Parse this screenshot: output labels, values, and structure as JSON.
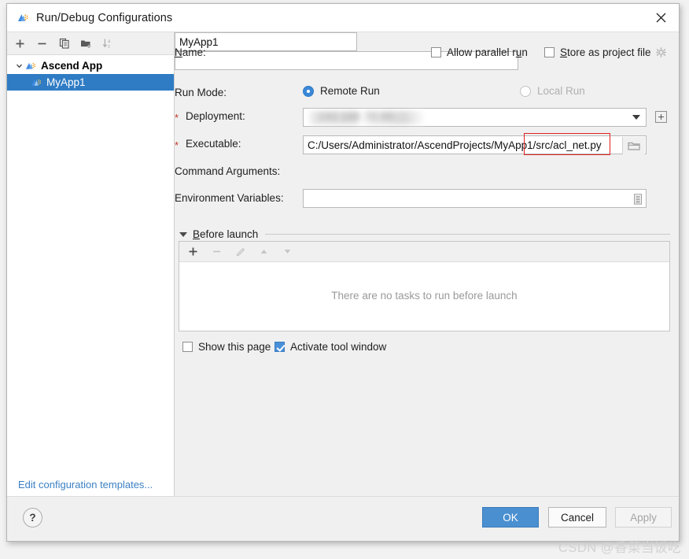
{
  "window": {
    "title": "Run/Debug Configurations",
    "app_icon": "ascend-app-icon",
    "close_icon": "close-icon"
  },
  "left_pane": {
    "toolbar": [
      {
        "name": "add-configuration-button",
        "icon": "plus-icon",
        "enabled": true
      },
      {
        "name": "remove-configuration-button",
        "icon": "minus-icon",
        "enabled": true
      },
      {
        "name": "copy-configuration-button",
        "icon": "copy-icon",
        "enabled": true
      },
      {
        "name": "new-folder-button",
        "icon": "folder-add-icon",
        "enabled": true
      },
      {
        "name": "sort-configurations-button",
        "icon": "sort-az-icon",
        "enabled": true
      }
    ],
    "tree": [
      {
        "label": "Ascend App",
        "type": "group",
        "expanded": true,
        "selected": false
      },
      {
        "label": "MyApp1",
        "type": "item",
        "expanded": false,
        "selected": true
      }
    ],
    "edit_templates_link": "Edit configuration templates..."
  },
  "form": {
    "name_label": "Name:",
    "name_label_mnemonic": "N",
    "name_value": "MyApp1",
    "name_placeholder": "",
    "allow_parallel_run": {
      "label_pre": "Allow parallel r",
      "label_mnemonic": "u",
      "label_post": "n",
      "checked": false
    },
    "store_as_project_file": {
      "label_mnemonic": "S",
      "label_post": "tore as project file",
      "checked": false,
      "gear_icon": "gear-icon"
    },
    "run_mode_label": "Run Mode:",
    "run_mode_options": [
      {
        "label": "Remote Run",
        "selected": true,
        "enabled": true
      },
      {
        "label": "Local Run",
        "selected": false,
        "enabled": false
      }
    ],
    "deployment_label": "Deployment:",
    "deployment_required": "*",
    "deployment_value": "",
    "deployment_blurred_hint": "192.168.70.95",
    "deployment_add_button_icon": "plus-box-icon",
    "executable_label": "Executable:",
    "executable_required": "*",
    "executable_value": "C:/Users/Administrator/AscendProjects/MyApp1/src/acl_net.py",
    "executable_browse_icon": "folder-browse-icon",
    "command_arguments_label": "Command Arguments:",
    "command_arguments_value": "",
    "environment_variables_label": "Environment Variables:",
    "environment_variables_value": "",
    "environment_variables_icon": "list-edit-icon"
  },
  "before_launch": {
    "title_mnemonic": "B",
    "title_post": "efore launch",
    "collapsed": false,
    "toolbar": [
      {
        "name": "add-task-button",
        "icon": "plus-icon",
        "enabled": true
      },
      {
        "name": "remove-task-button",
        "icon": "minus-icon",
        "enabled": false
      },
      {
        "name": "edit-task-button",
        "icon": "pencil-icon",
        "enabled": false
      },
      {
        "name": "move-task-up-button",
        "icon": "arrow-up-icon",
        "enabled": false
      },
      {
        "name": "move-task-down-button",
        "icon": "arrow-down-icon",
        "enabled": false
      }
    ],
    "empty_text": "There are no tasks to run before launch",
    "show_this_page": {
      "label": "Show this page",
      "checked": false
    },
    "activate_tool_window": {
      "label": "Activate tool window",
      "checked": true
    }
  },
  "footer": {
    "help_label": "?",
    "ok_label": "OK",
    "cancel_label": "Cancel",
    "apply_label": "Apply",
    "apply_enabled": false
  },
  "annotation": {
    "highlight_color": "#e02020",
    "highlighted_text": "1/src/acl_net.py"
  },
  "watermark": "CSDN @香菜当饭吃",
  "colors": {
    "selection_blue": "#2f7cc4",
    "primary_button": "#4a8fd0",
    "link_blue": "#3b80c4",
    "checkbox_blue": "#4a90d9",
    "required_star": "#c0392b",
    "annotation_red": "#e02020",
    "dialog_bg": "#f0f0f0"
  }
}
